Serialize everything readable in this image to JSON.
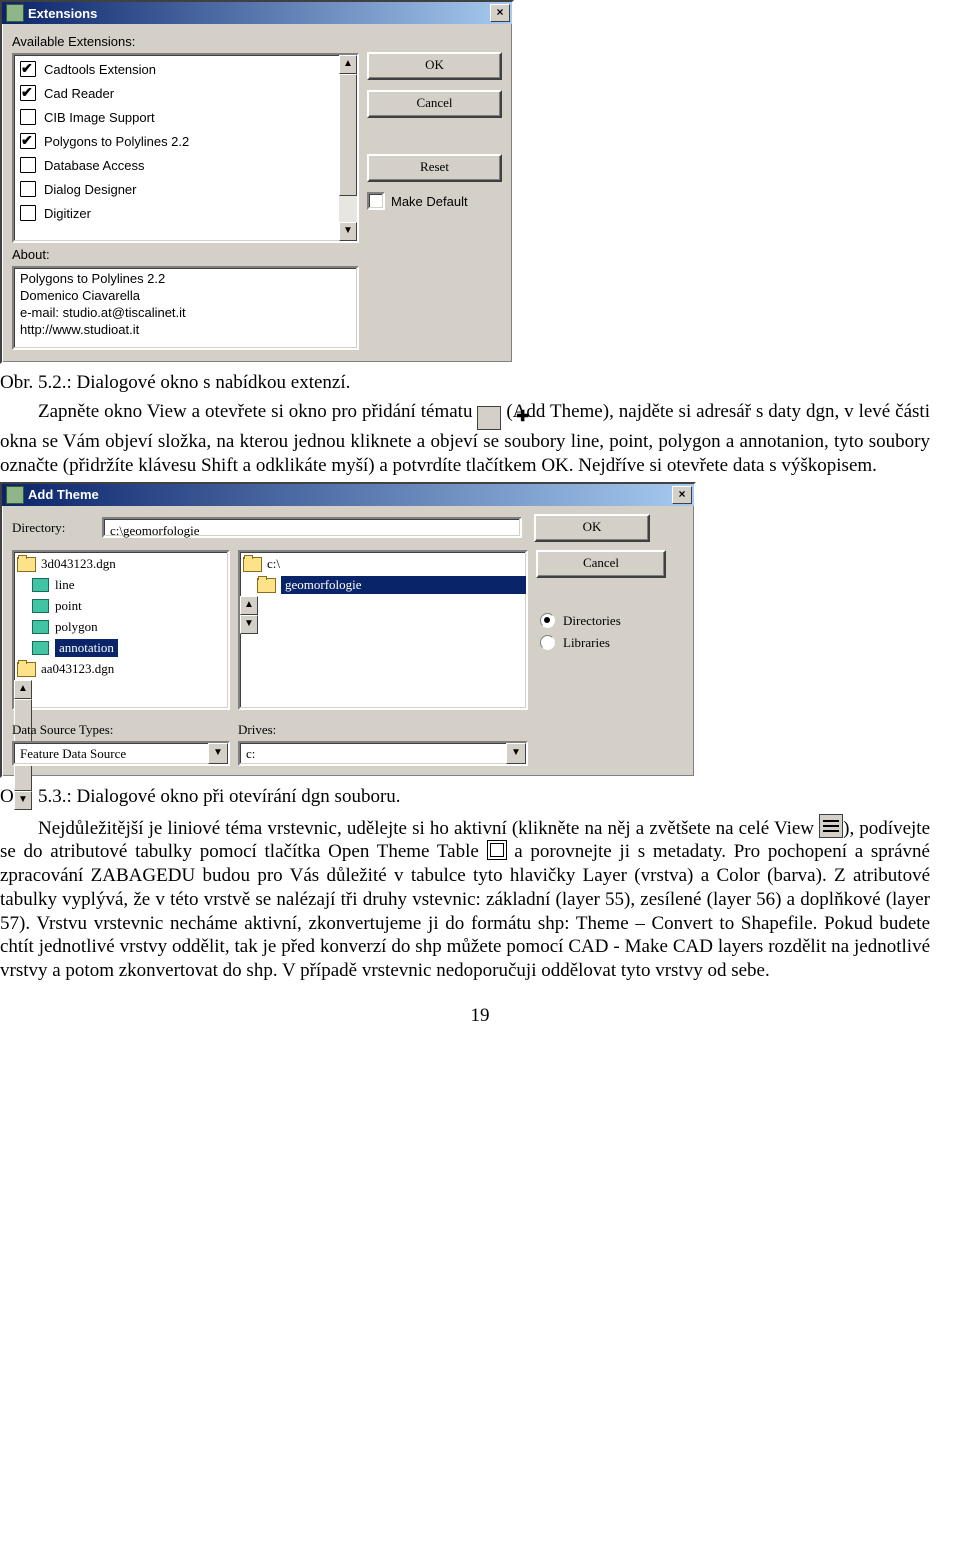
{
  "dlg1": {
    "title": "Extensions",
    "avail_label": "Available Extensions:",
    "items": [
      {
        "checked": true,
        "label": "Cadtools Extension"
      },
      {
        "checked": true,
        "label": "Cad Reader"
      },
      {
        "checked": false,
        "label": "CIB Image Support"
      },
      {
        "checked": true,
        "label": "Polygons to Polylines 2.2"
      },
      {
        "checked": false,
        "label": "Database Access"
      },
      {
        "checked": false,
        "label": "Dialog Designer"
      },
      {
        "checked": false,
        "label": "Digitizer"
      }
    ],
    "about_label": "About:",
    "about_text": "Polygons to Polylines 2.2\nDomenico Ciavarella\ne-mail: studio.at@tiscalinet.it\nhttp://www.studioat.it",
    "btn_ok": "OK",
    "btn_cancel": "Cancel",
    "btn_reset": "Reset",
    "make_default": "Make Default"
  },
  "caption1": "Obr. 5.2.: Dialogové okno s nabídkou extenzí.",
  "para1a": "Zapněte okno View a otevřete si okno pro přidání tématu ",
  "para1b": " (Add Theme), najděte si adresář s daty dgn, v levé části okna se Vám objeví složka, na kterou jednou kliknete a objeví se soubory line, point, polygon a annotanion, tyto soubory označte (přidržíte klávesu Shift a odklikáte myší) a potvrdíte tlačítkem OK. Nejdříve si otevřete data s výškopisem.",
  "dlg2": {
    "title": "Add Theme",
    "dir_label": "Directory:",
    "dir_value": "c:\\geomorfologie",
    "files": [
      {
        "type": "folder",
        "name": "3d043123.dgn"
      },
      {
        "type": "file",
        "name": "line"
      },
      {
        "type": "file",
        "name": "point"
      },
      {
        "type": "file",
        "name": "polygon"
      },
      {
        "type": "file",
        "name": "annotation",
        "selected": true
      },
      {
        "type": "folder",
        "name": "aa043123.dgn"
      }
    ],
    "dirs": [
      {
        "name": "c:\\"
      },
      {
        "name": "geomorfologie",
        "selected": true
      }
    ],
    "btn_ok": "OK",
    "btn_cancel": "Cancel",
    "radio_dir": "Directories",
    "radio_lib": "Libraries",
    "dst_label": "Data Source Types:",
    "dst_value": "Feature Data Source",
    "drives_label": "Drives:",
    "drives_value": "c:"
  },
  "caption2": "Obr. 5.3.: Dialogové okno při otevírání dgn souboru.",
  "para2a": "Nejdůležitější je liniové téma vrstevnic, udělejte si ho aktivní (klikněte na něj a zvětšete na celé View ",
  "para2b": "), podívejte se do atributové tabulky pomocí tlačítka Open Theme Table ",
  "para2c": "a porovnejte ji s metadaty. Pro pochopení a správné zpracování ZABAGEDU budou pro Vás důležité v tabulce tyto hlavičky Layer (vrstva) a Color (barva). Z atributové tabulky vyplývá, že v této vrstvě se nalézají tři druhy vstevnic: základní (layer 55), zesílené (layer 56) a doplňkové (layer 57). Vrstvu vrstevnic necháme aktivní, zkonvertujeme ji do formátu shp: Theme – Convert to Shapefile. Pokud budete chtít jednotlivé vrstvy oddělit, tak je před konverzí do shp můžete pomocí CAD - Make CAD layers rozdělit na jednotlivé vrstvy a potom zkonvertovat do shp. V případě vrstevnic nedoporučuji oddělovat tyto vrstvy od sebe.",
  "pagenum": "19"
}
